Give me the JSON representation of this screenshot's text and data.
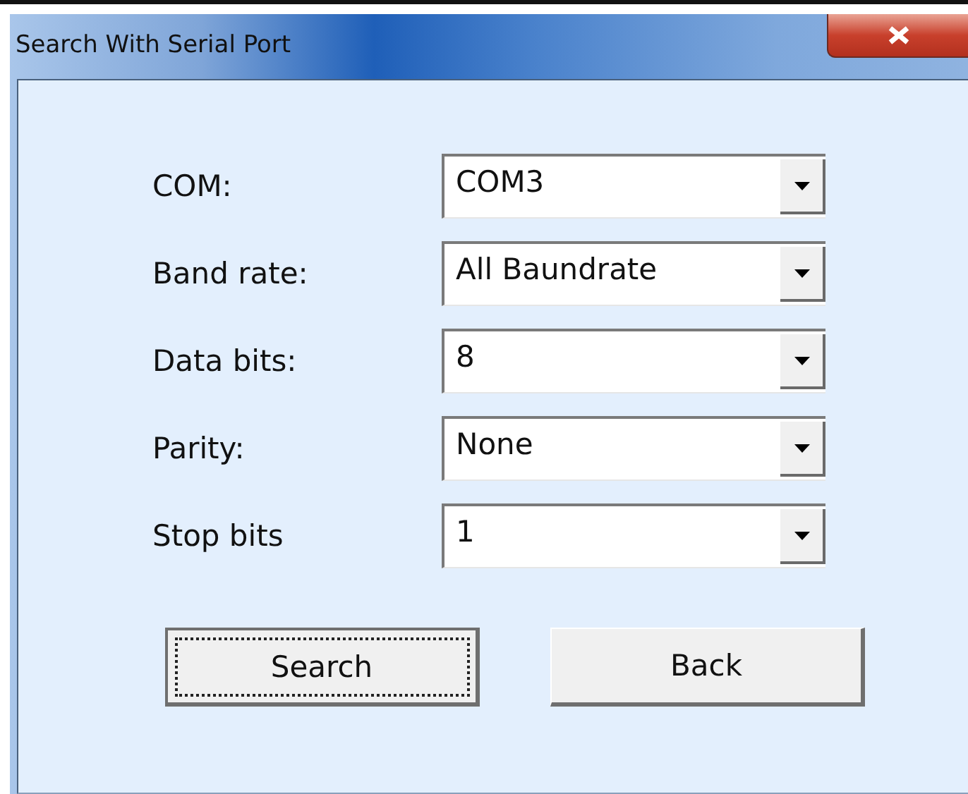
{
  "window": {
    "title": "Search With Serial Port"
  },
  "fields": [
    {
      "label": "COM:",
      "value": "COM3"
    },
    {
      "label": "Band rate:",
      "value": "All Baundrate"
    },
    {
      "label": "Data bits:",
      "value": "8"
    },
    {
      "label": "Parity:",
      "value": "None"
    },
    {
      "label": "Stop bits",
      "value": "1"
    }
  ],
  "buttons": [
    {
      "label": "Search",
      "focused": true
    },
    {
      "label": "Back",
      "focused": false
    }
  ]
}
